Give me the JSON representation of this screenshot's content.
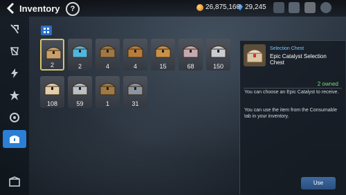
{
  "header": {
    "title": "Inventory",
    "help_symbol": "?",
    "gold": "26,875,160",
    "crystals": "29,245"
  },
  "colors": {
    "accent": "#2b7fd6",
    "owned": "#7fdc7a",
    "category": "#7fc6ff",
    "selected_border": "#d9c46a"
  },
  "sidebar": {
    "items": [
      {
        "icon": "equipment-icon"
      },
      {
        "icon": "artifact-icon"
      },
      {
        "icon": "lightning-icon"
      },
      {
        "icon": "material-icon"
      },
      {
        "icon": "catalyst-icon"
      },
      {
        "icon": "consumable-chest-icon",
        "active": true
      },
      {
        "icon": "storage-icon"
      }
    ]
  },
  "items": [
    {
      "name": "Selection Chest",
      "count": "2",
      "selected": true,
      "color": "#c9a06a"
    },
    {
      "name": "Chest",
      "count": "2",
      "color": "#4fb6e0"
    },
    {
      "name": "Chest",
      "count": "4",
      "color": "#a07845"
    },
    {
      "name": "Chest",
      "count": "4",
      "color": "#b67c3a"
    },
    {
      "name": "Chest",
      "count": "15",
      "color": "#c79148"
    },
    {
      "name": "Chest",
      "count": "68",
      "color": "#c5a8b0"
    },
    {
      "name": "Chest",
      "count": "150",
      "color": "#c8ccd4"
    },
    {
      "name": "Chest",
      "count": "108",
      "color": "#e2cfae"
    },
    {
      "name": "Chest",
      "count": "59",
      "color": "#b8c0c8"
    },
    {
      "name": "Chest",
      "count": "1",
      "color": "#9e7a45"
    },
    {
      "name": "Chest",
      "count": "31",
      "color": "#8a96a4"
    }
  ],
  "detail": {
    "category": "Selection Chest",
    "name": "Epic Catalyst Selection Chest",
    "owned": "2 owned",
    "desc1": "You can choose an Epic Catalyst to receive.",
    "desc2": "You can use the item from the Consumable tab in your inventory.",
    "use_label": "Use"
  }
}
